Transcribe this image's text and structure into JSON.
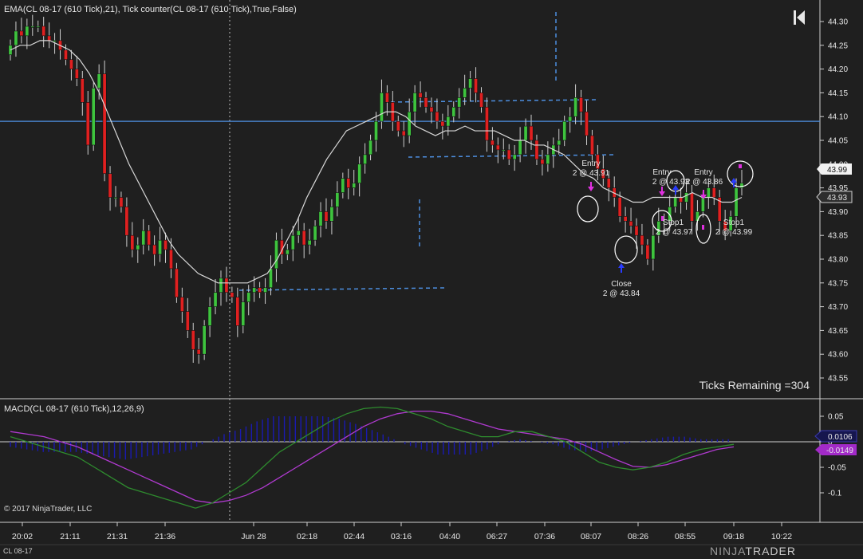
{
  "price_panel": {
    "title": "EMA(CL 08-17 (610 Tick),21), Tick counter(CL 08-17 (610 Tick),True,False)",
    "ticks_remaining": "Ticks Remaining =304",
    "last_price_label": "43.99",
    "ref_price_label": "43.93",
    "horizontal_line": 44.09
  },
  "macd_panel": {
    "title": "MACD(CL 08-17 (610 Tick),12,26,9)",
    "macd_value_label": "0.0106",
    "signal_value_label": "-0.0149",
    "copyright": "© 2017 NinjaTrader, LLC"
  },
  "footer": {
    "instrument": "CL 08-17",
    "brand_left": "NINJA",
    "brand_right": "TRADER"
  },
  "colors": {
    "up": "#3ec43e",
    "down": "#e02020",
    "ema": "#d8d8d8",
    "hline": "#4d8fe0",
    "dash": "#4d8fe0",
    "macd": "#2e8b2e",
    "signal": "#b03ad0",
    "hist": "#1a1ab0"
  },
  "trades": [
    {
      "label": "Entry",
      "detail": "2 @ 43.91"
    },
    {
      "label": "Close",
      "detail": "2 @ 43.84"
    },
    {
      "label": "Entry",
      "detail": "2 @ 43.93"
    },
    {
      "label": "Stop1",
      "detail": "2 @ 43.97"
    },
    {
      "label": "Entry",
      "detail": "2 @ 43.86"
    },
    {
      "label": "Stop1",
      "detail": "2 @ 43.99"
    }
  ],
  "chart_data": [
    {
      "type": "candlestick",
      "title": "EMA(CL 08-17 (610 Tick),21), Tick counter(CL 08-17 (610 Tick),True,False)",
      "x_ticks": [
        "20:02",
        "21:11",
        "21:31",
        "21:36",
        "Jun 28",
        "02:18",
        "02:44",
        "03:16",
        "04:40",
        "06:27",
        "07:36",
        "08:07",
        "08:26",
        "08:55",
        "09:18",
        "10:22"
      ],
      "y_ticks": [
        "44.30",
        "44.25",
        "44.20",
        "44.15",
        "44.10",
        "44.05",
        "44.00",
        "43.95",
        "43.90",
        "43.85",
        "43.80",
        "43.75",
        "43.70",
        "43.65",
        "43.60",
        "43.55"
      ],
      "ylim": [
        43.52,
        44.32
      ],
      "grid": false,
      "closes": [
        44.25,
        44.28,
        44.27,
        44.29,
        44.29,
        44.29,
        44.27,
        44.26,
        44.26,
        44.24,
        44.22,
        44.2,
        44.18,
        44.13,
        44.04,
        44.16,
        44.19,
        43.98,
        43.93,
        43.93,
        43.91,
        43.85,
        43.82,
        43.83,
        43.86,
        43.83,
        43.81,
        43.84,
        43.82,
        43.78,
        43.72,
        43.69,
        43.65,
        43.61,
        43.6,
        43.66,
        43.7,
        43.73,
        43.76,
        43.73,
        43.72,
        43.66,
        43.71,
        43.73,
        43.74,
        43.73,
        43.74,
        43.78,
        43.84,
        43.81,
        43.82,
        43.85,
        43.86,
        43.83,
        43.84,
        43.87,
        43.9,
        43.88,
        43.91,
        43.94,
        43.97,
        43.95,
        43.96,
        44.0,
        44.02,
        44.05,
        44.09,
        44.15,
        44.13,
        44.09,
        44.07,
        44.06,
        44.11,
        44.15,
        44.14,
        44.12,
        44.11,
        44.09,
        44.08,
        44.1,
        44.12,
        44.14,
        44.16,
        44.18,
        44.15,
        44.12,
        44.05,
        44.04,
        44.03,
        44.03,
        44.01,
        44.02,
        44.05,
        44.08,
        44.05,
        44.01,
        44.0,
        44.02,
        44.04,
        44.05,
        44.09,
        44.1,
        44.14,
        44.11,
        44.06,
        44.02,
        43.99,
        43.97,
        43.95,
        43.93,
        43.89,
        43.88,
        43.87,
        43.85,
        43.83,
        43.8,
        43.85,
        43.88,
        43.88,
        43.91,
        43.93,
        43.92,
        43.94,
        43.88,
        43.9,
        43.93,
        43.95,
        43.93,
        43.88,
        43.86,
        43.89,
        43.95,
        43.96
      ],
      "ema_21": [
        44.24,
        44.25,
        44.25,
        44.26,
        44.26,
        44.25,
        44.24,
        44.22,
        44.19,
        44.15,
        44.1,
        44.05,
        44.0,
        43.96,
        43.92,
        43.88,
        43.84,
        43.81,
        43.79,
        43.77,
        43.76,
        43.75,
        43.75,
        43.75,
        43.75,
        43.76,
        43.77,
        43.8,
        43.84,
        43.88,
        43.93,
        43.97,
        44.01,
        44.04,
        44.07,
        44.08,
        44.09,
        44.1,
        44.11,
        44.11,
        44.1,
        44.08,
        44.07,
        44.06,
        44.07,
        44.07,
        44.08,
        44.07,
        44.07,
        44.07,
        44.06,
        44.05,
        44.05,
        44.04,
        44.04,
        44.03,
        44.02,
        44.0,
        43.98,
        43.97,
        43.95,
        43.94,
        43.93,
        43.92,
        43.92,
        43.93,
        43.93,
        43.93,
        43.93,
        43.94,
        43.93,
        43.93,
        43.92,
        43.92,
        43.93
      ]
    },
    {
      "type": "line",
      "title": "MACD(CL 08-17 (610 Tick),12,26,9)",
      "y_ticks": [
        "0.05",
        "0",
        "-0.05",
        "-0.1"
      ],
      "ylim": [
        -0.135,
        0.07
      ],
      "series": [
        {
          "name": "MACD",
          "values": [
            0.01,
            0.0,
            -0.01,
            -0.02,
            -0.03,
            -0.05,
            -0.07,
            -0.09,
            -0.1,
            -0.11,
            -0.12,
            -0.13,
            -0.12,
            -0.1,
            -0.08,
            -0.05,
            -0.02,
            0.0,
            0.02,
            0.04,
            0.055,
            0.065,
            0.068,
            0.065,
            0.055,
            0.045,
            0.03,
            0.02,
            0.01,
            0.01,
            0.02,
            0.02,
            0.01,
            0.0,
            -0.02,
            -0.04,
            -0.05,
            -0.055,
            -0.05,
            -0.04,
            -0.025,
            -0.015,
            -0.01,
            -0.005
          ]
        },
        {
          "name": "Signal",
          "values": [
            0.02,
            0.015,
            0.01,
            0.0,
            -0.01,
            -0.025,
            -0.04,
            -0.055,
            -0.07,
            -0.085,
            -0.1,
            -0.115,
            -0.12,
            -0.115,
            -0.105,
            -0.09,
            -0.07,
            -0.05,
            -0.03,
            -0.01,
            0.01,
            0.03,
            0.045,
            0.055,
            0.06,
            0.06,
            0.055,
            0.045,
            0.035,
            0.025,
            0.02,
            0.015,
            0.01,
            0.005,
            -0.005,
            -0.02,
            -0.035,
            -0.048,
            -0.05,
            -0.045,
            -0.035,
            -0.025,
            -0.015,
            -0.01
          ]
        }
      ],
      "histogram": [
        -0.01,
        -0.015,
        -0.02,
        -0.02,
        -0.02,
        -0.025,
        -0.03,
        -0.035,
        -0.03,
        -0.025,
        -0.02,
        -0.015,
        0.0,
        0.015,
        0.025,
        0.04,
        0.05,
        0.05,
        0.05,
        0.05,
        0.045,
        0.035,
        0.023,
        0.01,
        -0.005,
        -0.015,
        -0.025,
        -0.025,
        -0.025,
        -0.015,
        0.0,
        0.005,
        0.0,
        -0.005,
        -0.015,
        -0.02,
        -0.015,
        -0.007,
        0.0,
        0.005,
        0.01,
        0.01,
        0.005,
        0.005
      ]
    }
  ]
}
